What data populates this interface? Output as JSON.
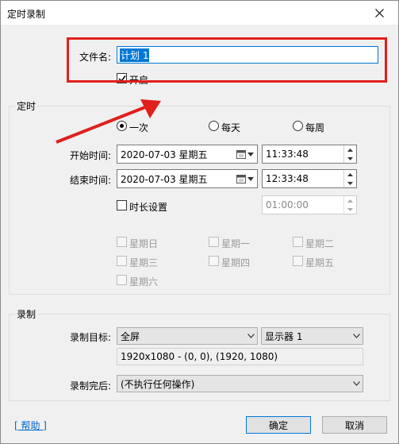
{
  "window": {
    "title": "定时录制"
  },
  "filename": {
    "label": "文件名:",
    "value": "计划 1"
  },
  "enable": {
    "label": "开启",
    "checked": true
  },
  "schedule": {
    "group_label": "定时",
    "radio_once": "一次",
    "radio_daily": "每天",
    "radio_weekly": "每周",
    "start_label": "开始时间:",
    "start_date": "2020-07-03 星期五",
    "start_time": "11:33:48",
    "end_label": "结束时间:",
    "end_date": "2020-07-03 星期五",
    "end_time": "12:33:48",
    "duration_label": "时长设置",
    "duration_value": "01:00:00",
    "weekdays": [
      "星期日",
      "星期一",
      "星期二",
      "星期三",
      "星期四",
      "星期五",
      "星期六"
    ]
  },
  "record": {
    "group_label": "录制",
    "target_label": "录制目标:",
    "target_value": "全屏",
    "monitor_value": "显示器 1",
    "region_text": "1920x1080 - (0, 0), (1920, 1080)",
    "after_label": "录制完后:",
    "after_value": "(不执行任何操作)"
  },
  "footer": {
    "help": "[ 帮助 ]",
    "ok": "确定",
    "cancel": "取消"
  },
  "annotation": {
    "highlight_color": "#e0201c"
  }
}
